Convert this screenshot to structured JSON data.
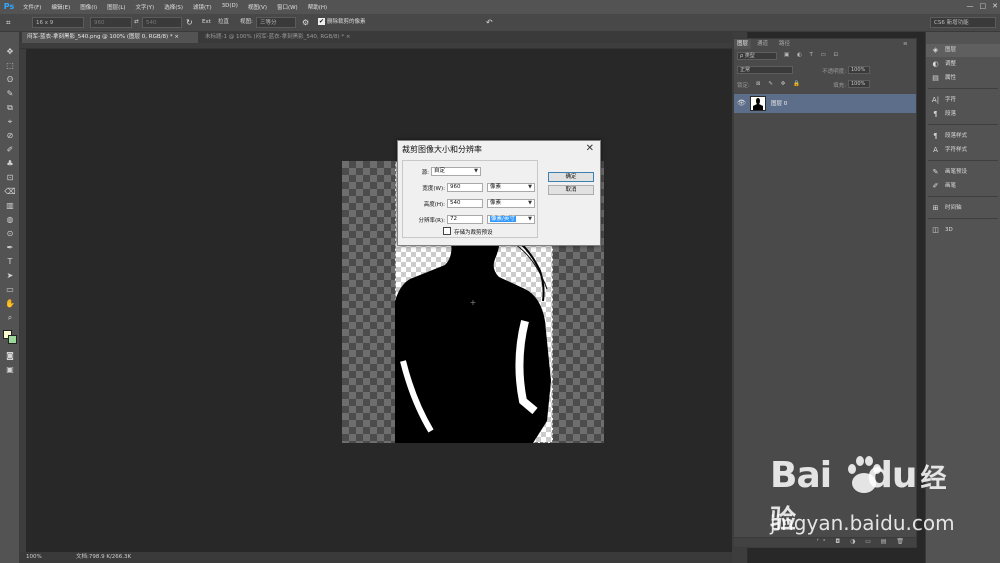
{
  "app": {
    "logo": "Ps"
  },
  "menubar": {
    "items": [
      "文件(F)",
      "编辑(E)",
      "图像(I)",
      "图层(L)",
      "文字(Y)",
      "选择(S)",
      "滤镜(T)",
      "3D(D)",
      "视图(V)",
      "窗口(W)",
      "帮助(H)"
    ],
    "window_controls": [
      "—",
      "□",
      "✕"
    ]
  },
  "options": {
    "ratio_preset": "16 x 9",
    "width_value": "960",
    "swap_symbol": "⇄",
    "height_value": "540",
    "clear_label": "Ext",
    "straighten_label": "拉直",
    "view_label": "视图:",
    "view_value": "三等分",
    "delete_cropped_label": "删除裁剪的像素",
    "delete_cropped_checked": "✔",
    "workspace": "CS6 新增功能"
  },
  "tabs": [
    {
      "label": "闷军-蓝衣-拿刻黑影_540.png @ 100% (图层 0, RGB/8) *",
      "close": "×"
    },
    {
      "label": "未标题-1 @ 100% (闷军-蓝衣-拿刻黑影_540, RGB/8) *",
      "close": "×"
    }
  ],
  "statusbar": {
    "zoom": "100%",
    "doc_info": "文档:798.9 K/266.3K"
  },
  "dialog": {
    "title": "裁剪图像大小和分辨率",
    "close": "✕",
    "preset_label": "源:",
    "preset_value": "自定",
    "width_label": "宽度(W):",
    "width_value": "960",
    "width_unit": "像素",
    "height_label": "高度(H):",
    "height_value": "540",
    "height_unit": "像素",
    "resolution_label": "分辨率(R):",
    "resolution_value": "72",
    "resolution_unit": "像素/英寸",
    "save_preset_label": "存储为裁剪预设",
    "ok": "确定",
    "cancel": "取消"
  },
  "layers_panel": {
    "tabs": [
      "图层",
      "通道",
      "路径"
    ],
    "kind_filter": "ρ 类型",
    "blend_mode": "正常",
    "opacity_label": "不透明度:",
    "opacity_value": "100%",
    "lock_label": "锁定:",
    "fill_label": "填充:",
    "fill_value": "100%",
    "layer_name": "图层 0",
    "bottom_icons": "ᶠˣ ◘ ◑ ▭ ▤ 🗑"
  },
  "dock": {
    "items": [
      {
        "label": "图层",
        "icon": "layers-icon",
        "glyph": "◈"
      },
      {
        "label": "调整",
        "icon": "adjust-icon",
        "glyph": "◐"
      },
      {
        "label": "属性",
        "icon": "properties-icon",
        "glyph": "▤"
      },
      {
        "label": "字符",
        "icon": "character-icon",
        "glyph": "A|"
      },
      {
        "label": "段落",
        "icon": "paragraph-icon",
        "glyph": "¶"
      },
      {
        "label": "段落样式",
        "icon": "paragraph-style-icon",
        "glyph": "¶"
      },
      {
        "label": "字符样式",
        "icon": "character-style-icon",
        "glyph": "A"
      },
      {
        "label": "画笔预设",
        "icon": "brush-presets-icon",
        "glyph": "✎"
      },
      {
        "label": "画笔",
        "icon": "brush-icon",
        "glyph": "✐"
      },
      {
        "label": "时间轴",
        "icon": "timeline-icon",
        "glyph": "⊞"
      },
      {
        "label": "3D",
        "icon": "3d-icon",
        "glyph": "◫"
      }
    ]
  },
  "tools": [
    "✥",
    "⬚",
    "ʘ",
    "✎",
    "⧉",
    "⌖",
    "⊘",
    "✐",
    "♣",
    "⊡",
    "⌫",
    "▥",
    "◍",
    "⊙",
    "✒",
    "T",
    "➤",
    "▭",
    "✋",
    "⌕",
    "■",
    "◙",
    "▣"
  ],
  "watermark": {
    "brand": "Bai",
    "brand2": "du",
    "cn": "经验",
    "url": "jingyan.baidu.com"
  }
}
